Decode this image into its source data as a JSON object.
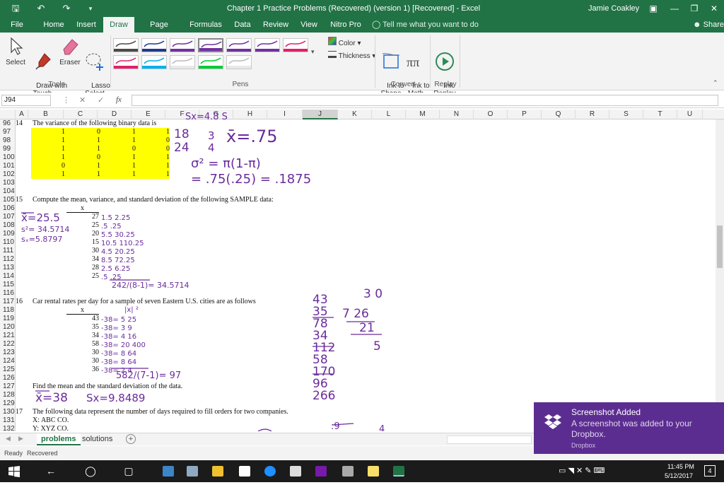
{
  "titlebar": {
    "title": "Chapter 1 Practice Problems (Recovered) (version 1) [Recovered]  -  Excel",
    "user": "Jamie Coakley",
    "save_icon": "save-icon",
    "undo_icon": "undo-icon",
    "redo_icon": "redo-icon",
    "qa_more_icon": "customize-icon"
  },
  "tabs": [
    "File",
    "Home",
    "Insert",
    "Draw",
    "Page Layout",
    "Formulas",
    "Data",
    "Review",
    "View",
    "Nitro Pro"
  ],
  "active_tab": "Draw",
  "tell_me": "Tell me what you want to do",
  "share": "Share",
  "ribbon": {
    "tools": [
      {
        "label": "Select"
      },
      {
        "label": "Draw with\nTouch"
      },
      {
        "label": "Eraser"
      },
      {
        "label": "Lasso\nSelect"
      }
    ],
    "group_tools": "Tools",
    "group_pens": "Pens",
    "group_convert": "Convert",
    "group_replay": "Replay",
    "color_label": "Color",
    "thickness_label": "Thickness",
    "ink_to_shape": "Ink to\nShape",
    "ink_to_math": "Ink to\nMath",
    "ink_replay": "Ink\nReplay",
    "pen_colors": [
      "#4a4a4a",
      "#1e3a8a",
      "#7030a0",
      "#7030a0",
      "#7030a0",
      "#7030a0",
      "#e0206a",
      "#e0206a",
      "#00b0f0",
      "#e8e8e8",
      "#00cc33",
      "#e8e8e8"
    ]
  },
  "formula_bar": {
    "name_box": "J94",
    "fx": "fx",
    "value": ""
  },
  "columns": [
    "A",
    "B",
    "C",
    "D",
    "E",
    "F",
    "G",
    "H",
    "I",
    "J",
    "K",
    "L",
    "M",
    "N",
    "O",
    "P",
    "Q",
    "R",
    "S",
    "T",
    "U"
  ],
  "rows": [
    "96",
    "97",
    "98",
    "99",
    "100",
    "101",
    "102",
    "103",
    "104",
    "105",
    "106",
    "107",
    "108",
    "109",
    "110",
    "111",
    "112",
    "113",
    "114",
    "115",
    "116",
    "117",
    "118",
    "119",
    "120",
    "121",
    "122",
    "123",
    "124",
    "125",
    "126",
    "127",
    "128",
    "129",
    "130",
    "131",
    "132"
  ],
  "cells": {
    "r96a": "14",
    "r96": "The variance of the following binary data is",
    "binary": [
      [
        1,
        0,
        1,
        1
      ],
      [
        1,
        1,
        1,
        0
      ],
      [
        1,
        1,
        0,
        0
      ],
      [
        1,
        0,
        1,
        1
      ],
      [
        0,
        1,
        1,
        1
      ],
      [
        1,
        1,
        1,
        1
      ]
    ],
    "r105a": "15",
    "r105": "Compute the mean, variance, and standard deviation of the following SAMPLE data:",
    "x_header": "x",
    "sample15": [
      "27",
      "25",
      "20",
      "15",
      "30",
      "34",
      "28",
      "25"
    ],
    "r117a": "16",
    "r117": "Car rental rates per day for a sample of seven Eastern U.S. cities are as follows",
    "x_header2": "x",
    "rental": [
      "43",
      "35",
      "34",
      "58",
      "30",
      "30",
      "36"
    ],
    "r127": "Find the mean and the standard deviation of the data.",
    "r130a": "17",
    "r130": "The following data represent the number of days required to fill orders for two companies.",
    "r131": "X:  ABC CO.",
    "r132": "Y: XYZ CO."
  },
  "ink_text": {
    "top": "Sx=4.8 S",
    "p14_frac1": "18",
    "p14_frac2": "24",
    "p14_eq1": "3",
    "p14_eq2": "4",
    "p14_mean": "x̄=.75",
    "p14_var1": "σ² = π(1-π)",
    "p14_var2": "= .75(.25) = .1875",
    "p15_mean": "x̄=25.5",
    "p15_var": "s²= 34.5714",
    "p15_sd": "sₓ=5.8797",
    "p15_dev": [
      "1.5  2.25",
      ".5  .25",
      "5.5  30.25",
      "10.5 110.25",
      "4.5  20.25",
      "8.5  72.25",
      "2.5  6.25",
      ".5  .25"
    ],
    "p15_sum": "242/(8-1)= 34.5714",
    "p16_dev": [
      "-38= 5  25",
      "-38= 3  9",
      "-38= 4  16",
      "-38= 20  400",
      "-38= 8  64",
      "-38= 8  64",
      "-38= 2  4"
    ],
    "p16_hdr": "|x|  ²",
    "p16_sum": "582/(7-1)= 97",
    "p16_mean": "x̄=38",
    "p16_sd": "Sx=9.8489",
    "addition": [
      "43",
      "35",
      "78",
      "34",
      "112",
      "58",
      "170",
      "96",
      "266"
    ],
    "division": [
      "3 0",
      "7  26",
      "21",
      "5"
    ],
    "bottom1": ":9",
    "bottom2": "4"
  },
  "sheet_tabs": [
    "problems",
    "solutions"
  ],
  "active_sheet": "problems",
  "status": {
    "ready": "Ready",
    "recovered": "Recovered"
  },
  "toast": {
    "title": "Screenshot Added",
    "body": "A screenshot was added to your Dropbox.",
    "source": "Dropbox"
  },
  "taskbar": {
    "time": "11:45 PM",
    "date": "5/12/2017",
    "notif_count": "4"
  }
}
